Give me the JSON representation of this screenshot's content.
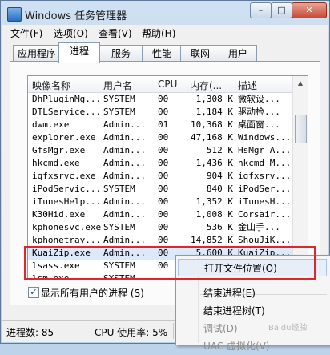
{
  "window": {
    "title": "Windows 任务管理器",
    "controls": {
      "minimize": "–",
      "maximize": "□",
      "close": "✕"
    }
  },
  "menu": [
    "文件(F)",
    "选项(O)",
    "查看(V)",
    "帮助(H)"
  ],
  "tabs": [
    "应用程序",
    "进程",
    "服务",
    "性能",
    "联网",
    "用户"
  ],
  "active_tab": "进程",
  "table": {
    "headers": [
      "映像名称",
      "用户名",
      "CPU",
      "内存(...",
      "描述"
    ],
    "rows": [
      [
        "DhPluginMg...",
        "SYSTEM",
        "00",
        "1,308 K",
        "微软设..."
      ],
      [
        "DTLService...",
        "SYSTEM",
        "00",
        "1,184 K",
        "驱动检..."
      ],
      [
        "dwm.exe",
        "Admin...",
        "01",
        "10,368 K",
        "桌面窗..."
      ],
      [
        "explorer.exe",
        "Admin...",
        "00",
        "47,168 K",
        "Windows..."
      ],
      [
        "GfsMgr.exe",
        "Admin...",
        "00",
        "512 K",
        "HsMgr A..."
      ],
      [
        "hkcmd.exe",
        "Admin...",
        "00",
        "1,436 K",
        "hkcmd M..."
      ],
      [
        "igfxsrvc.exe",
        "Admin...",
        "00",
        "904 K",
        "igfxsrv..."
      ],
      [
        "iPodServic...",
        "SYSTEM",
        "00",
        "840 K",
        "iPodSer..."
      ],
      [
        "iTunesHelp...",
        "Admin...",
        "00",
        "1,352 K",
        "iTunesH..."
      ],
      [
        "K30Hid.exe",
        "Admin...",
        "00",
        "1,008 K",
        "Corsair..."
      ],
      [
        "kphonesvc.exe",
        "SYSTEM",
        "00",
        "536 K",
        "金山手..."
      ],
      [
        "kphonetray...",
        "Admin...",
        "00",
        "14,852 K",
        "ShouJiK..."
      ],
      [
        "KuaiZip.exe",
        "Admin...",
        "00",
        "5,600 K",
        "KuaiZip..."
      ],
      [
        "lsass.exe",
        "SYSTEM",
        "00",
        "",
        ""
      ],
      [
        "lsm.exe",
        "SYSTEM",
        "",
        "",
        ""
      ]
    ],
    "selected_index": 12
  },
  "show_all_users": {
    "checked": true,
    "label": "显示所有用户的进程 (S)",
    "check_glyph": "✓"
  },
  "context_menu": {
    "items": [
      {
        "label": "打开文件位置(O)",
        "highlighted": true,
        "disabled": false
      },
      {
        "label": "结束进程(E)",
        "highlighted": false,
        "disabled": false
      },
      {
        "label": "结束进程树(T)",
        "highlighted": false,
        "disabled": false
      },
      {
        "label": "调试(D)",
        "highlighted": false,
        "disabled": true
      },
      {
        "label": "UAC 虚拟化(V)",
        "highlighted": false,
        "disabled": true
      }
    ]
  },
  "status_bar": {
    "processes": "进程数: 85",
    "cpu": "CPU 使用率: 5%"
  },
  "watermark": "Baidu经验",
  "colors": {
    "selection": "#dbe9f9",
    "highlight_box": "#e0262c",
    "titlebar": "#bcd3ea"
  }
}
